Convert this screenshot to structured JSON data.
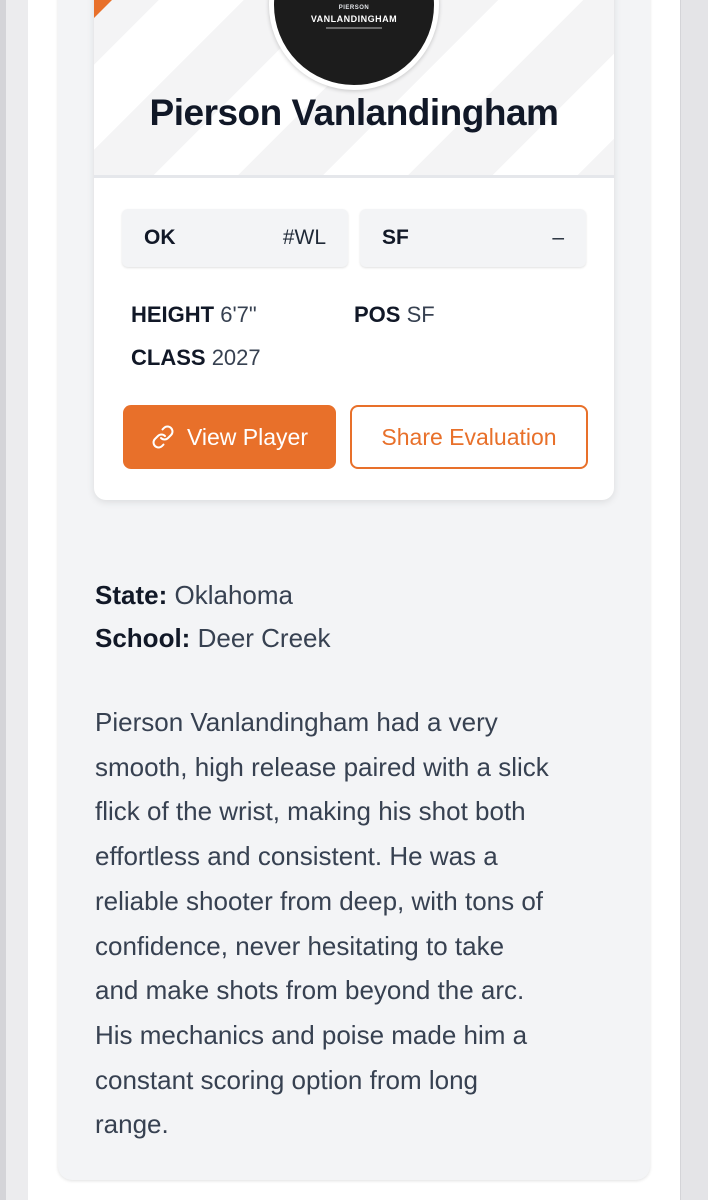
{
  "player": {
    "avatar_caption_small": "PIERSON",
    "avatar_caption_name": "VANLANDINGHAM",
    "name": "Pierson Vanlandingham"
  },
  "chips": [
    {
      "key": "OK",
      "value": "#WL"
    },
    {
      "key": "SF",
      "value": "–"
    }
  ],
  "stats": {
    "height_label": "HEIGHT",
    "height_value": "6'7\"",
    "pos_label": "POS",
    "pos_value": "SF",
    "class_label": "CLASS",
    "class_value": "2027"
  },
  "buttons": {
    "view_player": "View Player",
    "view_player_icon": "link-icon",
    "share_evaluation": "Share Evaluation"
  },
  "details": {
    "state_label": "State:",
    "state_value": "Oklahoma",
    "school_label": "School:",
    "school_value": "Deer Creek"
  },
  "bio_lines": [
    "Pierson Vanlandingham had a very",
    "smooth, high release paired with a slick",
    "flick of the wrist, making his shot both",
    "effortless and consistent. He was a",
    "reliable shooter from deep, with tons of",
    "confidence, never hesitating to take",
    "and make shots from beyond the arc.",
    "His mechanics and poise made him a",
    "constant scoring option from long",
    "range."
  ],
  "colors": {
    "accent": "#e8702a",
    "page_bg": "#f3f4f6",
    "text_dark": "#111827"
  }
}
